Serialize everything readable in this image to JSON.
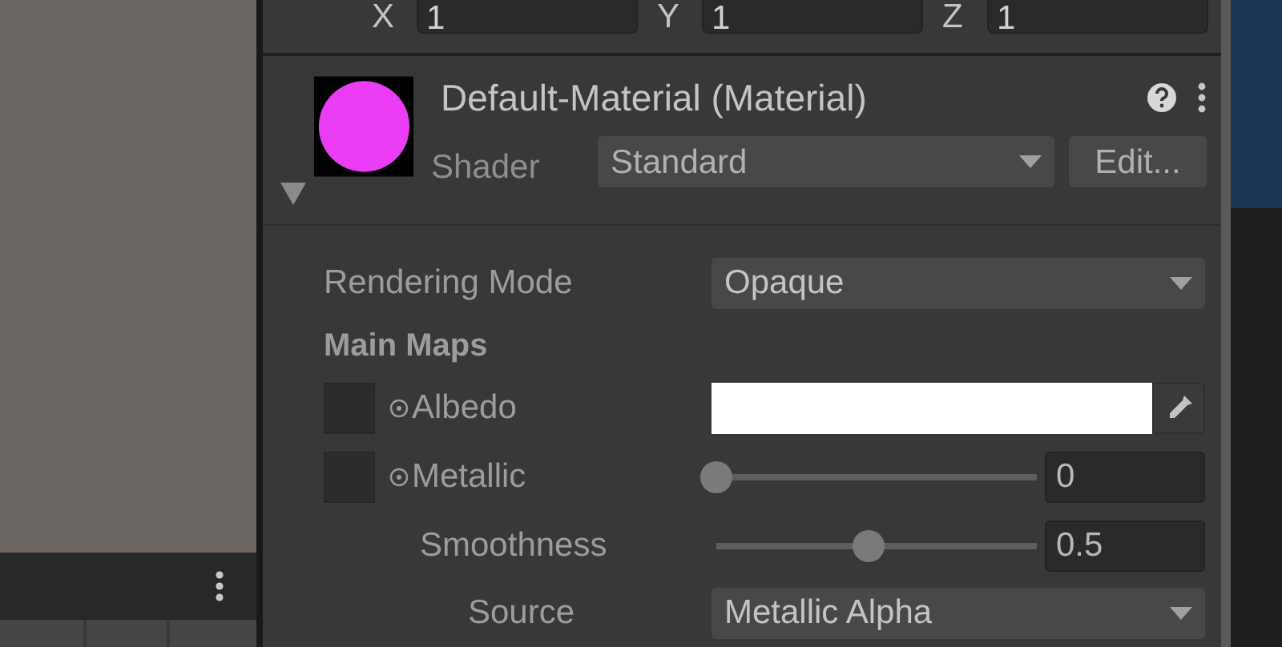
{
  "scale": [
    {
      "axis": "X",
      "value": "1"
    },
    {
      "axis": "Y",
      "value": "1"
    },
    {
      "axis": "Z",
      "value": "1"
    }
  ],
  "material": {
    "title": "Default-Material (Material)",
    "expanded": true,
    "shader_label": "Shader",
    "shader": "Standard",
    "edit_button": "Edit..."
  },
  "properties": [
    {
      "kind": "dropdown",
      "label": "Rendering Mode",
      "value": "Opaque"
    },
    {
      "kind": "header",
      "label": "Main Maps"
    },
    {
      "kind": "color",
      "label": "Albedo",
      "texture_slot": true
    },
    {
      "kind": "slider",
      "label": "Metallic",
      "texture_slot": true,
      "level": 0,
      "value": "0"
    },
    {
      "kind": "slider",
      "label": "Smoothness",
      "texture_slot": false,
      "level": 0.5,
      "value": "0.5"
    },
    {
      "kind": "dropdown",
      "label": "Source",
      "value": "Metallic Alpha",
      "indent": true
    }
  ]
}
